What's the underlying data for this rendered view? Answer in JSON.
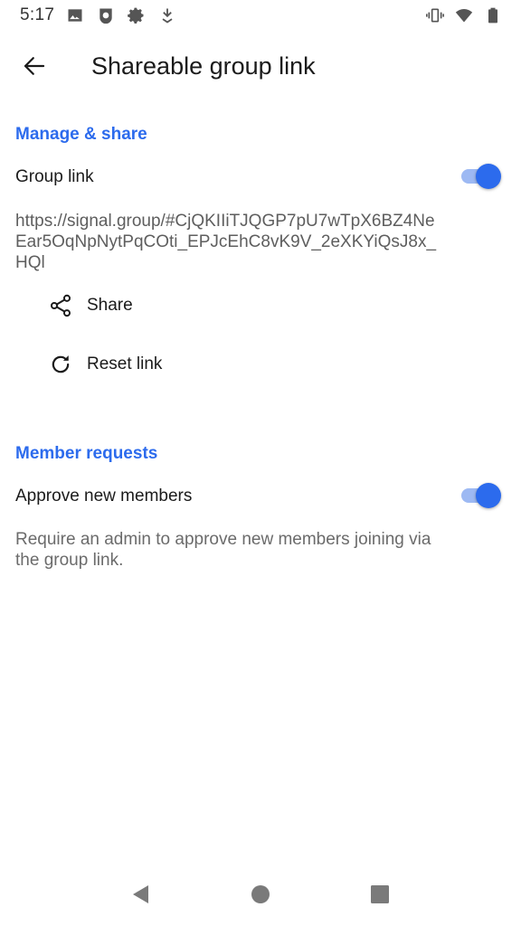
{
  "status_bar": {
    "time": "5:17",
    "left_icons": [
      "image-icon",
      "signal-app-icon",
      "settings-gear-icon",
      "download-arrow-icon"
    ],
    "right_icons": [
      "vibrate-icon",
      "wifi-icon",
      "battery-icon"
    ]
  },
  "app_bar": {
    "back_icon": "arrow-left-icon",
    "title": "Shareable group link"
  },
  "manage_section": {
    "header": "Manage & share",
    "group_link_label": "Group link",
    "group_link_enabled": true,
    "link_url": "https://signal.group/#CjQKIIiTJQGP7pU7wTpX6BZ4NeEar5OqNpNytPqCOti_EPJcEhC8vK9V_2eXKYiQsJ8x_HQl",
    "share_label": "Share",
    "share_icon": "share-icon",
    "reset_label": "Reset link",
    "reset_icon": "refresh-icon"
  },
  "requests_section": {
    "header": "Member requests",
    "approve_label": "Approve new members",
    "approve_enabled": true,
    "approve_description": "Require an admin to approve new members joining via the group link."
  },
  "nav_bar": {
    "icons": [
      "back-triangle-icon",
      "home-circle-icon",
      "recents-square-icon"
    ]
  },
  "colors": {
    "accent": "#2c6bed",
    "toggle_track": "#9db9f3",
    "primary_text": "#1b1b1b",
    "secondary_text": "#5e5e5e"
  }
}
